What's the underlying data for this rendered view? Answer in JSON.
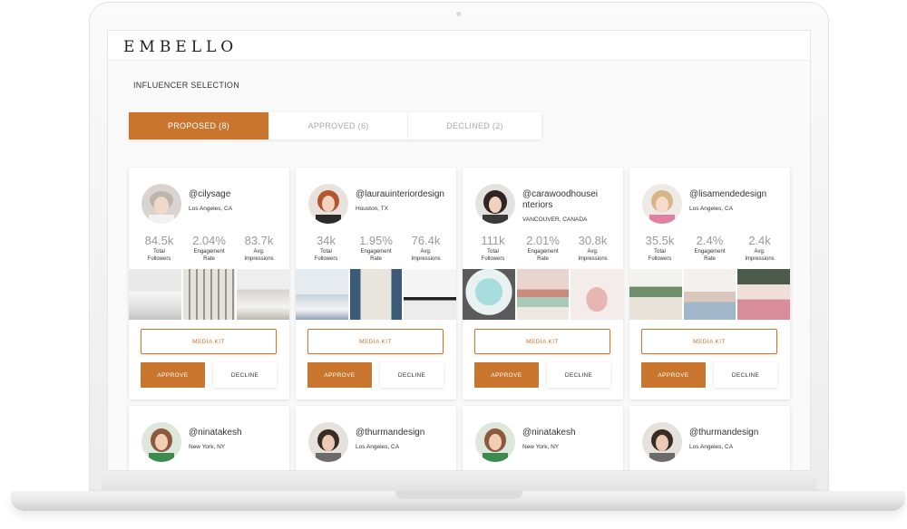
{
  "app": {
    "logo": "EMBELLO"
  },
  "page": {
    "title": "INFLUENCER SELECTION"
  },
  "tabs": [
    {
      "label": "PROPOSED (8)",
      "active": true
    },
    {
      "label": "APPROVED (6)",
      "active": false
    },
    {
      "label": "DECLINED (2)",
      "active": false
    }
  ],
  "stat_labels": {
    "followers": "Total\nFollowers",
    "engagement": "Engagement\nRate",
    "impressions": "Avg.\nImpressions"
  },
  "buttons": {
    "media_kit": "MEDIA KIT",
    "approve": "APPROVE",
    "decline": "DECLINE"
  },
  "influencers": [
    {
      "handle": "@cilysage",
      "location": "Los Angeles, CA",
      "followers": "84.5k",
      "engagement": "2.04%",
      "impressions": "83.7k"
    },
    {
      "handle": "@laurauinteriordesign",
      "location": "Houston, TX",
      "followers": "34k",
      "engagement": "1.95%",
      "impressions": "76.4k"
    },
    {
      "handle": "@carawoodhouseinteriors",
      "location": "VANCOUVER, CANADA",
      "followers": "111k",
      "engagement": "2.01%",
      "impressions": "30.8k"
    },
    {
      "handle": "@lisamendedesign",
      "location": "Los Angeles, CA",
      "followers": "35.5k",
      "engagement": "2.4%",
      "impressions": "2.4k"
    },
    {
      "handle": "@ninatakesh",
      "location": "New York, NY"
    },
    {
      "handle": "@thurmandesign",
      "location": "Los Angeles, CA"
    },
    {
      "handle": "@ninatakesh",
      "location": "New York, NY"
    },
    {
      "handle": "@thurmandesign",
      "location": "Los Angeles, CA"
    }
  ],
  "colors": {
    "accent": "#c9752e",
    "muted_stat": "#999999"
  }
}
